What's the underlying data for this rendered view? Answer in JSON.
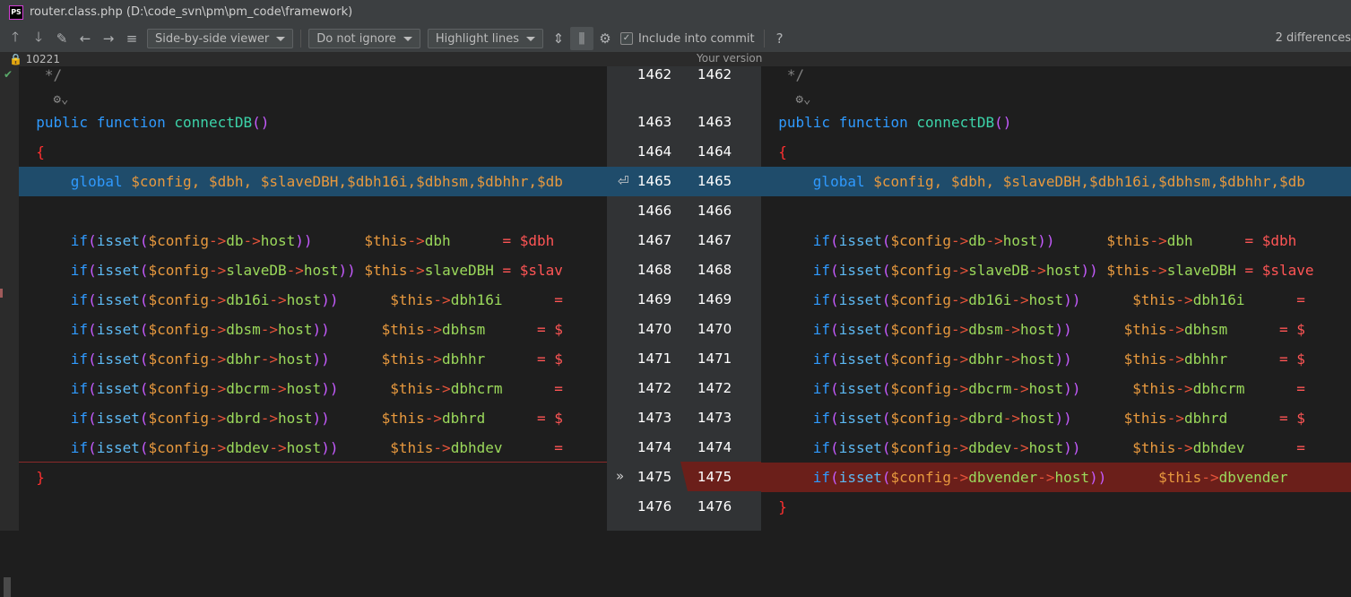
{
  "window": {
    "app_icon": "PS",
    "title": "router.class.php (D:\\code_svn\\pm\\pm_code\\framework)",
    "controls": [
      "—",
      "☐",
      "✕"
    ]
  },
  "toolbar": {
    "viewer": "Side-by-side viewer",
    "ignore": "Do not ignore",
    "highlight": "Highlight lines",
    "include_commit": "Include into commit",
    "include_checked": true,
    "help": "?",
    "differences": "2 differences"
  },
  "info": {
    "revision": "10221",
    "your_version": "Your version"
  },
  "colors": {
    "blue_highlight": "#1f4c6b",
    "red_highlight": "#6b1f1a",
    "keyword": "#2f9aff",
    "variable": "#e8993e",
    "property": "#9bd95b",
    "brace": "#ff3030"
  },
  "line_numbers": [
    "1462",
    "1463",
    "1464",
    "1465",
    "1466",
    "1467",
    "1468",
    "1469",
    "1470",
    "1471",
    "1472",
    "1473",
    "1474",
    "1475",
    "1476"
  ],
  "code": {
    "comment_end": "*/",
    "public": "public",
    "function": "function",
    "fn_name": "connectDB",
    "open_brace": "{",
    "close_brace": "}",
    "global_kw": "global",
    "global_vars_left": "$config, $dbh, $slaveDBH,$dbh16i,$dbhsm,$dbhhr,$db",
    "global_vars_right": "$config, $dbh, $slaveDBH,$dbh16i,$dbhsm,$dbhhr,$db",
    "if_lines": [
      {
        "prop": "db",
        "gap": "      ",
        "target": "dbh",
        "tail": "      = $dbh"
      },
      {
        "prop": "slaveDB",
        "gap": " ",
        "target": "slaveDBH",
        "tail": " = $slav"
      },
      {
        "prop": "db16i",
        "gap": "      ",
        "target": "dbh16i",
        "tail": "      ="
      },
      {
        "prop": "dbsm",
        "gap": "      ",
        "target": "dbhsm",
        "tail": "      = $"
      },
      {
        "prop": "dbhr",
        "gap": "      ",
        "target": "dbhhr",
        "tail": "      = $"
      },
      {
        "prop": "dbcrm",
        "gap": "      ",
        "target": "dbhcrm",
        "tail": "      ="
      },
      {
        "prop": "dbrd",
        "gap": "      ",
        "target": "dbhrd",
        "tail": "      = $"
      },
      {
        "prop": "dbdev",
        "gap": "      ",
        "target": "dbhdev",
        "tail": "      ="
      }
    ],
    "if_lines_right_tails": [
      "      = $dbh",
      " = $slave",
      "      =",
      "      = $",
      "      = $",
      "      =",
      "      = $",
      "      ="
    ],
    "added_line": {
      "prop": "dbvender",
      "gap": "      ",
      "target": "dbvender"
    }
  }
}
